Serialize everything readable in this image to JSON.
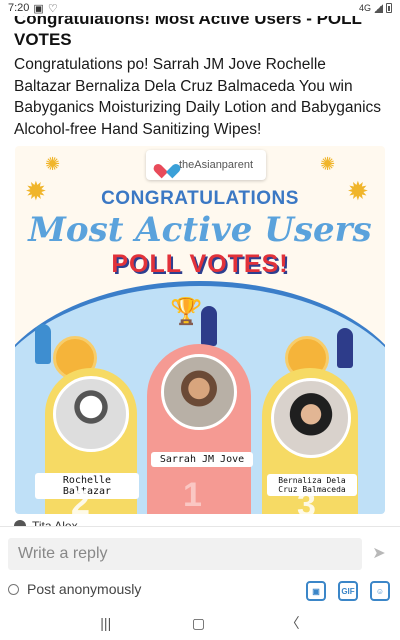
{
  "status_bar": {
    "time": "7:20",
    "network": "4G"
  },
  "post": {
    "title": "Congratulations! Most Active Users - POLL VOTES",
    "body": "Congratulations po! Sarrah JM Jove Rochelle Baltazar Bernaliza Dela Cruz Balmaceda You win Babyganics Moisturizing Daily Lotion and Babyganics Alcohol-free Hand Sanitizing Wipes!"
  },
  "banner": {
    "brand": "theAsianparent",
    "congrats": "CONGRATULATIONS",
    "headline": "Most Active Users",
    "subheadline": "POLL VOTES!",
    "winners": [
      {
        "rank": "2",
        "name": "Rochelle Baltazar"
      },
      {
        "rank": "1",
        "name": "Sarrah JM Jove"
      },
      {
        "rank": "3",
        "name": "Bernaliza Dela Cruz Balmaceda"
      }
    ]
  },
  "next_post_author": "Tita Alex",
  "reply": {
    "placeholder": "Write a reply",
    "anonymous_label": "Post anonymously"
  },
  "colors": {
    "accent": "#3b86c8",
    "poll": "#e2323a",
    "pedestal_gold": "#f6da64",
    "pedestal_pink": "#f59a93"
  },
  "icons": [
    "image-icon",
    "gif-icon",
    "sticker-icon",
    "send-icon"
  ]
}
